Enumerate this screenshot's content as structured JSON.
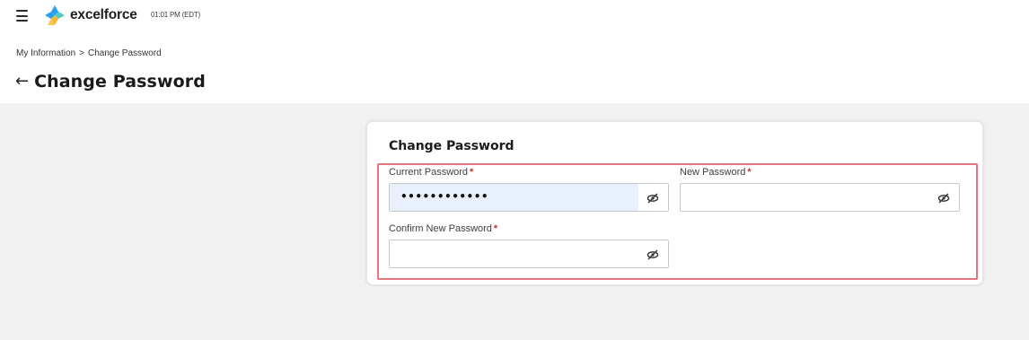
{
  "header": {
    "logo_text": "excelforce",
    "clock": "01:01 PM (EDT)"
  },
  "breadcrumb": {
    "items": [
      "My Information",
      "Change Password"
    ],
    "separator": ">"
  },
  "page": {
    "title": "Change Password",
    "back_arrow": "←"
  },
  "form": {
    "title": "Change Password",
    "required_marker": "*",
    "current_password": {
      "label": "Current Password",
      "value": "••••••••••••"
    },
    "new_password": {
      "label": "New Password",
      "value": ""
    },
    "confirm_password": {
      "label": "Confirm New Password",
      "value": ""
    }
  },
  "icons": {
    "menu": "hamburger-menu-icon",
    "visibility": "eye-slash-icon"
  },
  "colors": {
    "highlight_border": "#e5747c",
    "required": "#c0392b",
    "autofill_bg": "#e8f0fe",
    "logo_blue": "#2a9df4",
    "logo_yellow": "#f5b82e",
    "logo_teal": "#4ecdc4"
  }
}
